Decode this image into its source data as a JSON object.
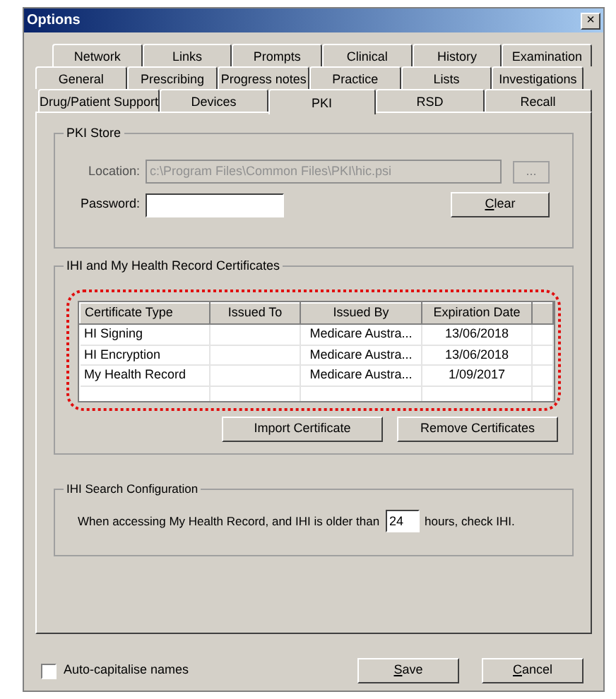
{
  "window": {
    "title": "Options",
    "close": "×"
  },
  "tab_rows": [
    [
      {
        "label": "Network",
        "selected": false
      },
      {
        "label": "Links",
        "selected": false
      },
      {
        "label": "Prompts",
        "selected": false
      },
      {
        "label": "Clinical",
        "selected": false
      },
      {
        "label": "History",
        "selected": false
      },
      {
        "label": "Examination",
        "selected": false
      }
    ],
    [
      {
        "label": "General",
        "selected": false
      },
      {
        "label": "Prescribing",
        "selected": false
      },
      {
        "label": "Progress notes",
        "selected": false
      },
      {
        "label": "Practice",
        "selected": false
      },
      {
        "label": "Lists",
        "selected": false
      },
      {
        "label": "Investigations",
        "selected": false
      }
    ],
    [
      {
        "label": "Drug/Patient Support",
        "selected": false
      },
      {
        "label": "Devices",
        "selected": false
      },
      {
        "label": "PKI",
        "selected": true
      },
      {
        "label": "RSD",
        "selected": false
      },
      {
        "label": "Recall",
        "selected": false
      }
    ]
  ],
  "pki_store": {
    "title": "PKI Store",
    "location_label": "Location:",
    "location_value": "c:\\Program Files\\Common Files\\PKI\\hic.psi",
    "location_disabled": true,
    "browse_button": "...",
    "password_label": "Password:",
    "clear_button": {
      "label": "Clear",
      "mnemonic": true
    }
  },
  "certificates": {
    "title": "IHI and My Health Record Certificates",
    "table": {
      "columns": [
        "Certificate Type",
        "Issued To",
        "Issued By",
        "Expiration Date"
      ],
      "rows": [
        [
          "HI Signing",
          "",
          "Medicare Austra...",
          "13/06/2018"
        ],
        [
          "HI Encryption",
          "",
          "Medicare Austra...",
          "13/06/2018"
        ],
        [
          "My Health Record",
          "",
          "Medicare Austra...",
          "1/09/2017"
        ]
      ]
    },
    "buttons": [
      "Import Certificate",
      "Remove Certificates"
    ]
  },
  "ihi_search": {
    "title": "IHI Search Configuration",
    "text_before": "When accessing My Health Record, and IHI is older than",
    "hours": "24",
    "text_after": "hours, check IHI."
  },
  "auto_capitalise": {
    "label": "Auto-capitalise names",
    "checked": false
  },
  "footer_buttons": [
    {
      "label": "Save",
      "mnemonic": true
    },
    {
      "label": "Cancel",
      "mnemonic": true
    }
  ]
}
